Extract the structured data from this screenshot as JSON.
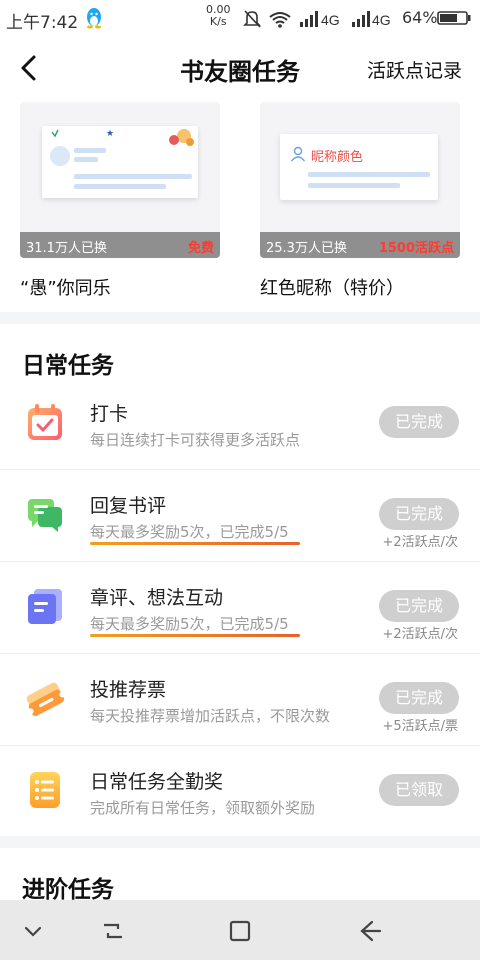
{
  "status_bar": {
    "time": "上午7:42",
    "speed_value": "0.00",
    "speed_unit": "K/s",
    "battery": "64%"
  },
  "header": {
    "title": "书友圈任务",
    "right_link": "活跃点记录"
  },
  "rewards": [
    {
      "count": "31.1万人已换",
      "price": "免费",
      "title": "“愚”你同乐"
    },
    {
      "count": "25.3万人已换",
      "price": "1500活跃点",
      "title": "红色昵称（特价）",
      "preview_text": "昵称颜色"
    }
  ],
  "daily": {
    "title": "日常任务",
    "tasks": [
      {
        "name": "打卡",
        "desc": "每日连续打卡可获得更多活跃点",
        "button": "已完成",
        "reward": "",
        "icon": "calendar-check-icon"
      },
      {
        "name": "回复书评",
        "desc": "每天最多奖励5次，已完成5/5",
        "button": "已完成",
        "reward": "+2活跃点/次",
        "icon": "chat-bubbles-icon"
      },
      {
        "name": "章评、想法互动",
        "desc": "每天最多奖励5次，已完成5/5",
        "button": "已完成",
        "reward": "+2活跃点/次",
        "icon": "note-cards-icon"
      },
      {
        "name": "投推荐票",
        "desc": "每天投推荐票增加活跃点，不限次数",
        "button": "已完成",
        "reward": "+5活跃点/票",
        "icon": "ticket-icon"
      },
      {
        "name": "日常任务全勤奖",
        "desc": "完成所有日常任务，领取额外奖励",
        "button": "已领取",
        "reward": "",
        "icon": "list-icon"
      }
    ]
  },
  "advanced": {
    "title": "进阶任务"
  },
  "colors": {
    "accent_red": "#ff3b30",
    "button_done": "#cfcfcf",
    "progress_orange": "#e8602c"
  }
}
